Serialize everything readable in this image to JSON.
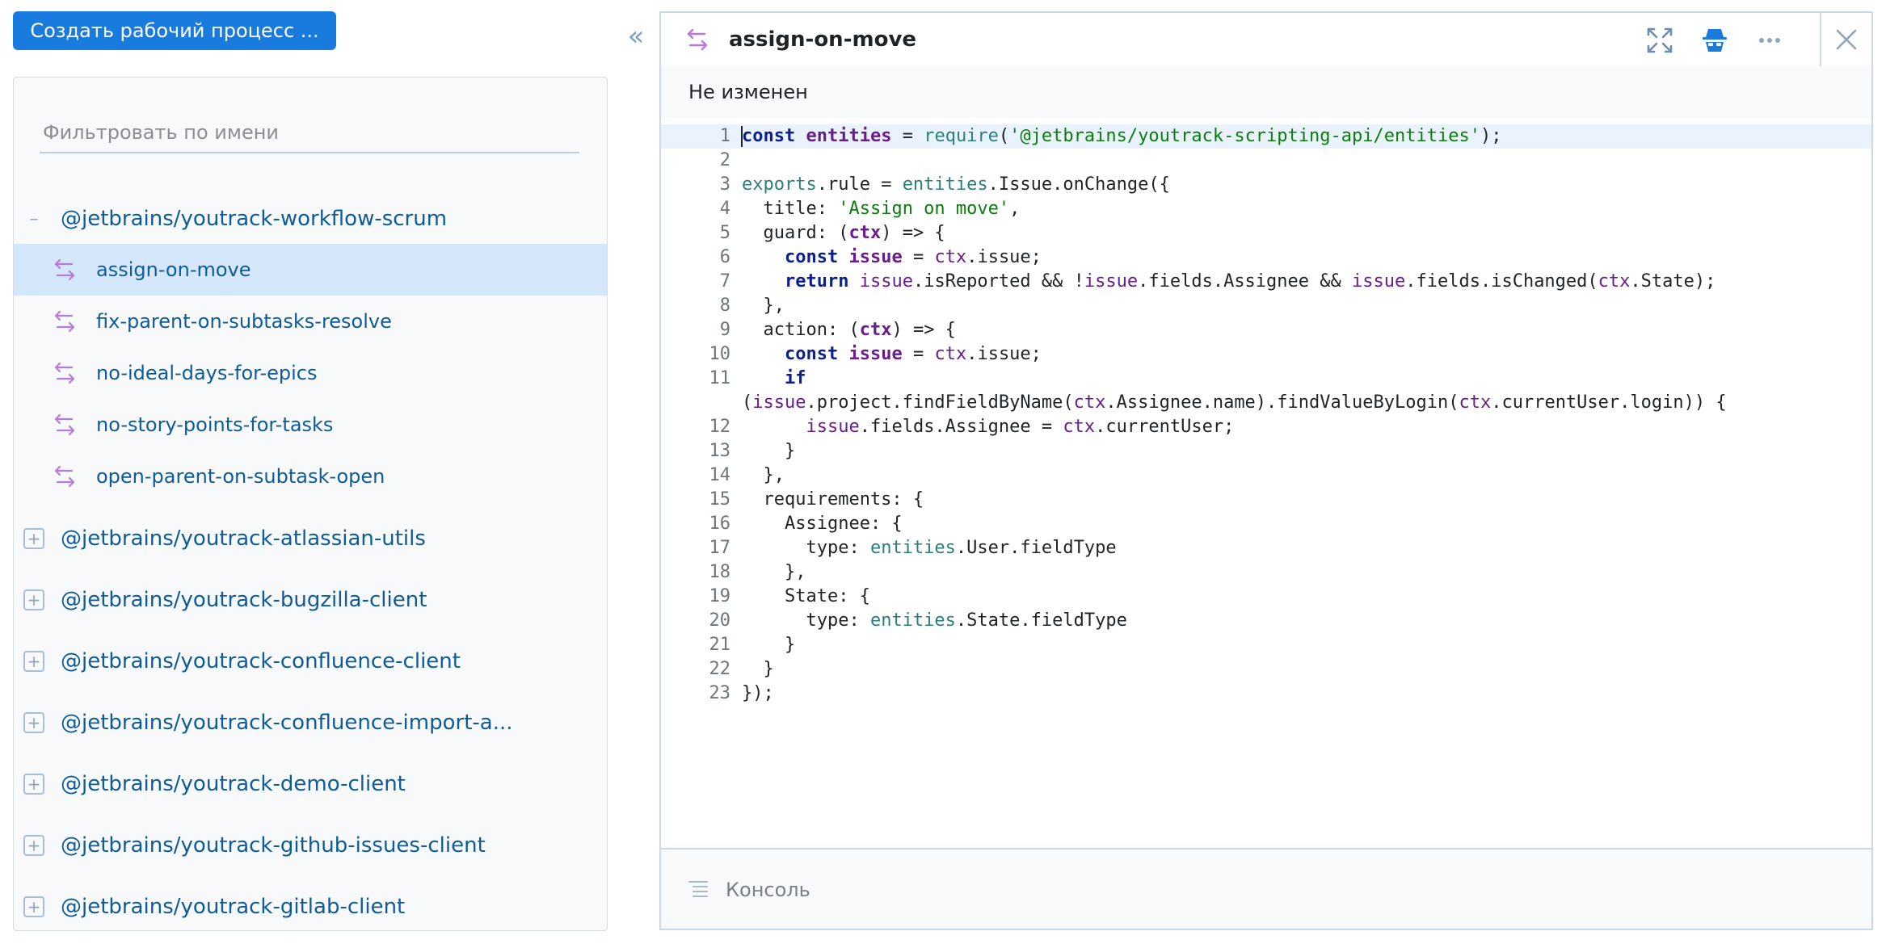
{
  "sidebar": {
    "create_button": "Создать рабочий процесс ...",
    "filter_placeholder": "Фильтровать по имени",
    "expanded_package": {
      "name": "@jetbrains/youtrack-workflow-scrum",
      "rules": [
        {
          "name": "assign-on-move",
          "selected": true
        },
        {
          "name": "fix-parent-on-subtasks-resolve",
          "selected": false
        },
        {
          "name": "no-ideal-days-for-epics",
          "selected": false
        },
        {
          "name": "no-story-points-for-tasks",
          "selected": false
        },
        {
          "name": "open-parent-on-subtask-open",
          "selected": false
        }
      ]
    },
    "collapsed_packages": [
      "@jetbrains/youtrack-atlassian-utils",
      "@jetbrains/youtrack-bugzilla-client",
      "@jetbrains/youtrack-confluence-client",
      "@jetbrains/youtrack-confluence-import-a...",
      "@jetbrains/youtrack-demo-client",
      "@jetbrains/youtrack-github-issues-client",
      "@jetbrains/youtrack-gitlab-client"
    ],
    "collapse_glyph": "«"
  },
  "editor": {
    "title": "assign-on-move",
    "status": "Не изменен",
    "console_label": "Консоль",
    "icons": [
      "rule-icon",
      "expand-icon",
      "incognito-icon",
      "more-icon",
      "close-icon"
    ],
    "code_lines": [
      {
        "n": "1",
        "tokens": [
          [
            "kw",
            "const"
          ],
          [
            "p",
            " "
          ],
          [
            "vb",
            "entities"
          ],
          [
            "p",
            " = "
          ],
          [
            "fn",
            "require"
          ],
          [
            "p",
            "("
          ],
          [
            "st",
            "'@jetbrains/youtrack-scripting-api/entities'"
          ],
          [
            "p",
            ");"
          ]
        ]
      },
      {
        "n": "2",
        "tokens": []
      },
      {
        "n": "3",
        "tokens": [
          [
            "fn",
            "exports"
          ],
          [
            "p",
            ".rule = "
          ],
          [
            "fn",
            "entities"
          ],
          [
            "p",
            ".Issue.onChange({"
          ]
        ]
      },
      {
        "n": "4",
        "tokens": [
          [
            "p",
            "  title: "
          ],
          [
            "st",
            "'Assign on move'"
          ],
          [
            "p",
            ","
          ]
        ]
      },
      {
        "n": "5",
        "tokens": [
          [
            "p",
            "  guard: ("
          ],
          [
            "vb",
            "ctx"
          ],
          [
            "p",
            ") => {"
          ]
        ]
      },
      {
        "n": "6",
        "tokens": [
          [
            "p",
            "    "
          ],
          [
            "kw",
            "const"
          ],
          [
            "p",
            " "
          ],
          [
            "vb",
            "issue"
          ],
          [
            "p",
            " = "
          ],
          [
            "vr",
            "ctx"
          ],
          [
            "p",
            ".issue;"
          ]
        ]
      },
      {
        "n": "7",
        "tokens": [
          [
            "p",
            "    "
          ],
          [
            "kw",
            "return"
          ],
          [
            "p",
            " "
          ],
          [
            "vr",
            "issue"
          ],
          [
            "p",
            ".isReported && !"
          ],
          [
            "vr",
            "issue"
          ],
          [
            "p",
            ".fields.Assignee && "
          ],
          [
            "vr",
            "issue"
          ],
          [
            "p",
            ".fields.isChanged("
          ],
          [
            "vr",
            "ctx"
          ],
          [
            "p",
            ".State);"
          ]
        ]
      },
      {
        "n": "8",
        "tokens": [
          [
            "p",
            "  },"
          ]
        ]
      },
      {
        "n": "9",
        "tokens": [
          [
            "p",
            "  action: ("
          ],
          [
            "vb",
            "ctx"
          ],
          [
            "p",
            ") => {"
          ]
        ]
      },
      {
        "n": "10",
        "tokens": [
          [
            "p",
            "    "
          ],
          [
            "kw",
            "const"
          ],
          [
            "p",
            " "
          ],
          [
            "vb",
            "issue"
          ],
          [
            "p",
            " = "
          ],
          [
            "vr",
            "ctx"
          ],
          [
            "p",
            ".issue;"
          ]
        ]
      },
      {
        "n": "11",
        "tokens": [
          [
            "p",
            "    "
          ],
          [
            "kw",
            "if"
          ]
        ]
      },
      {
        "n": "",
        "tokens": [
          [
            "p",
            "("
          ],
          [
            "vr",
            "issue"
          ],
          [
            "p",
            ".project.findFieldByName("
          ],
          [
            "vr",
            "ctx"
          ],
          [
            "p",
            ".Assignee.name).findValueByLogin("
          ],
          [
            "vr",
            "ctx"
          ],
          [
            "p",
            ".currentUser.login)) {"
          ]
        ]
      },
      {
        "n": "12",
        "tokens": [
          [
            "p",
            "      "
          ],
          [
            "vr",
            "issue"
          ],
          [
            "p",
            ".fields.Assignee = "
          ],
          [
            "vr",
            "ctx"
          ],
          [
            "p",
            ".currentUser;"
          ]
        ]
      },
      {
        "n": "13",
        "tokens": [
          [
            "p",
            "    }"
          ]
        ]
      },
      {
        "n": "14",
        "tokens": [
          [
            "p",
            "  },"
          ]
        ]
      },
      {
        "n": "15",
        "tokens": [
          [
            "p",
            "  requirements: {"
          ]
        ]
      },
      {
        "n": "16",
        "tokens": [
          [
            "p",
            "    Assignee: {"
          ]
        ]
      },
      {
        "n": "17",
        "tokens": [
          [
            "p",
            "      type: "
          ],
          [
            "fn",
            "entities"
          ],
          [
            "p",
            ".User.fieldType"
          ]
        ]
      },
      {
        "n": "18",
        "tokens": [
          [
            "p",
            "    },"
          ]
        ]
      },
      {
        "n": "19",
        "tokens": [
          [
            "p",
            "    State: {"
          ]
        ]
      },
      {
        "n": "20",
        "tokens": [
          [
            "p",
            "      type: "
          ],
          [
            "fn",
            "entities"
          ],
          [
            "p",
            ".State.fieldType"
          ]
        ]
      },
      {
        "n": "21",
        "tokens": [
          [
            "p",
            "    }"
          ]
        ]
      },
      {
        "n": "22",
        "tokens": [
          [
            "p",
            "  }"
          ]
        ]
      },
      {
        "n": "23",
        "tokens": [
          [
            "p",
            "});"
          ]
        ]
      }
    ]
  },
  "colors": {
    "accent": "#1a7bdf",
    "link": "#0f5b9a",
    "selection": "#d5e8fb",
    "rule_icon": "#b779e0",
    "keyword": "#0b1f8f",
    "variable": "#6a1d8a",
    "string": "#0a7d0a",
    "builtin": "#2b7e7e"
  }
}
